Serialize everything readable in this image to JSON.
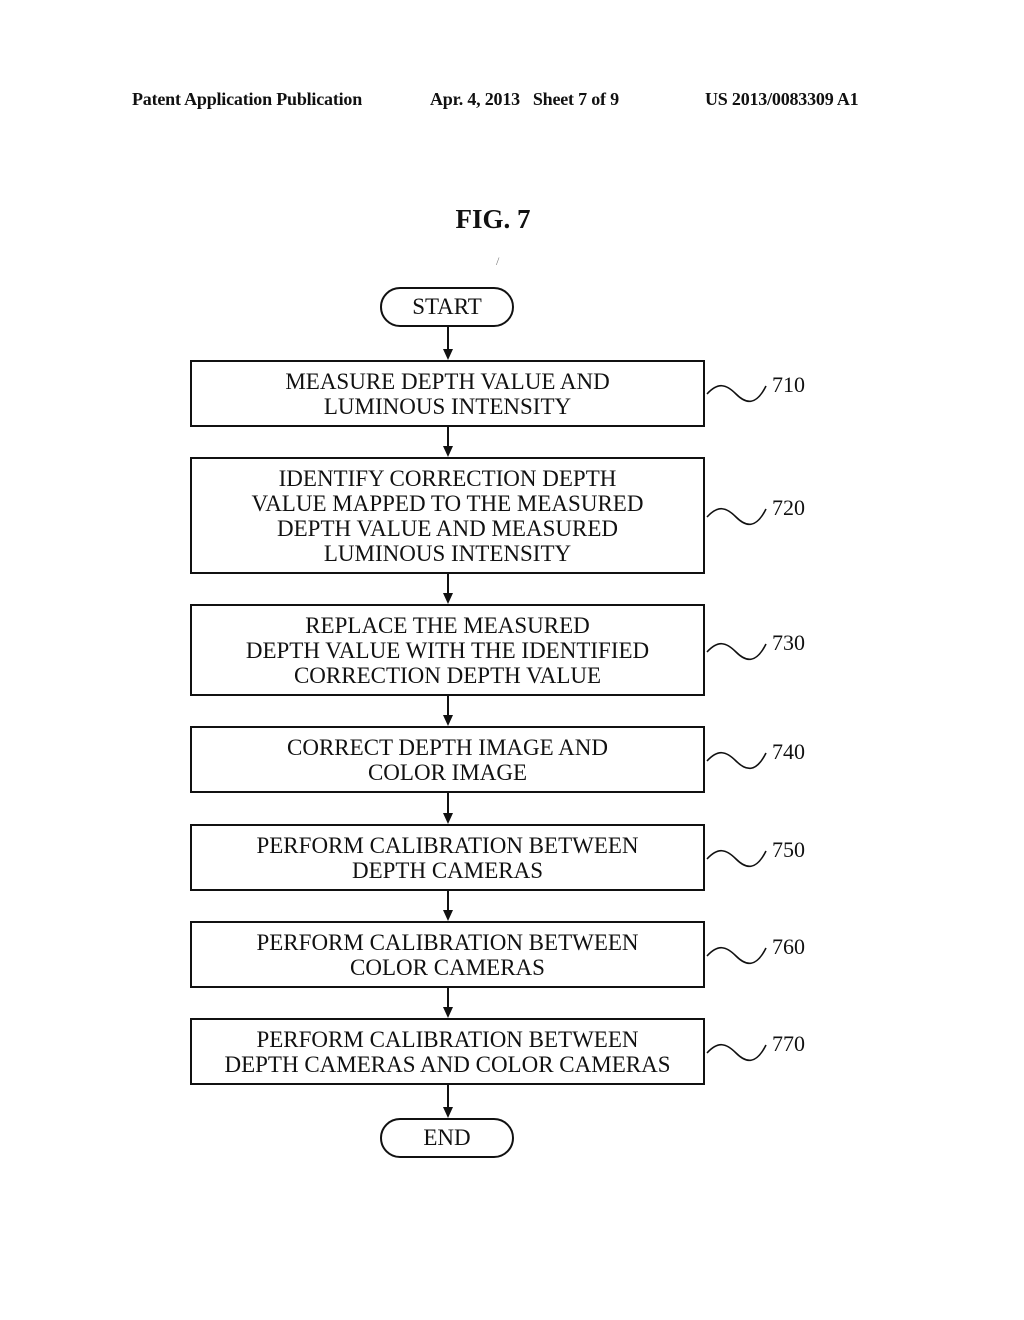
{
  "header": {
    "publication": "Patent Application Publication",
    "date_sheet": "Apr. 4, 2013   Sheet 7 of 9",
    "number": "US 2013/0083309 A1"
  },
  "figure": {
    "title": "FIG. 7",
    "start_label": "START",
    "end_label": "END",
    "steps": [
      {
        "ref": "710",
        "text": "MEASURE DEPTH VALUE AND\nLUMINOUS INTENSITY"
      },
      {
        "ref": "720",
        "text": "IDENTIFY CORRECTION DEPTH\nVALUE MAPPED TO THE MEASURED\nDEPTH VALUE AND MEASURED\nLUMINOUS INTENSITY"
      },
      {
        "ref": "730",
        "text": "REPLACE THE MEASURED\nDEPTH VALUE WITH THE IDENTIFIED\nCORRECTION DEPTH VALUE"
      },
      {
        "ref": "740",
        "text": "CORRECT DEPTH IMAGE AND\nCOLOR IMAGE"
      },
      {
        "ref": "750",
        "text": "PERFORM CALIBRATION BETWEEN\nDEPTH CAMERAS"
      },
      {
        "ref": "760",
        "text": "PERFORM CALIBRATION BETWEEN\nCOLOR CAMERAS"
      },
      {
        "ref": "770",
        "text": "PERFORM CALIBRATION BETWEEN\nDEPTH CAMERAS AND COLOR CAMERAS"
      }
    ]
  }
}
